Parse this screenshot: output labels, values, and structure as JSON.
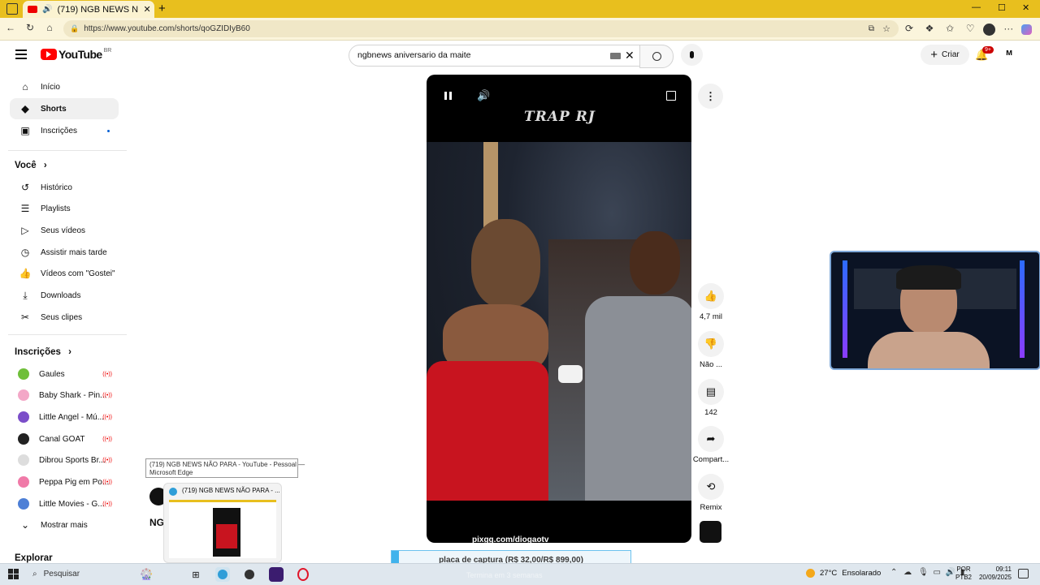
{
  "browser": {
    "tab_title": "(719) NGB NEWS NÃO PARA",
    "url": "https://www.youtube.com/shorts/qoGZIDIyB60",
    "window_minimize": "—",
    "window_maximize": "☐",
    "window_close": "✕"
  },
  "youtube": {
    "logo_text": "YouTube",
    "region": "BR",
    "search_value": "ngbnews aniversario da maite",
    "create_label": "Criar",
    "notif_count": "9+"
  },
  "sidebar": {
    "items": [
      {
        "label": "Início",
        "icon": "home-icon"
      },
      {
        "label": "Shorts",
        "icon": "shorts-icon"
      },
      {
        "label": "Inscrições",
        "icon": "subscriptions-icon"
      }
    ],
    "you_title": "Você",
    "you_items": [
      {
        "label": "Histórico"
      },
      {
        "label": "Playlists"
      },
      {
        "label": "Seus vídeos"
      },
      {
        "label": "Assistir mais tarde"
      },
      {
        "label": "Vídeos com \"Gostei\""
      },
      {
        "label": "Downloads"
      },
      {
        "label": "Seus clipes"
      }
    ],
    "subs_title": "Inscrições",
    "subs": [
      {
        "label": "Gaules",
        "color": "#6fbf3a"
      },
      {
        "label": "Baby Shark - Pin...",
        "color": "#f3a7c7"
      },
      {
        "label": "Little Angel - Mú...",
        "color": "#7b4ec9"
      },
      {
        "label": "Canal GOAT",
        "color": "#222222"
      },
      {
        "label": "Dibrou Sports Br...",
        "color": "#dddddd"
      },
      {
        "label": "Peppa Pig em Po...",
        "color": "#f07aa8"
      },
      {
        "label": "Little Movies - G...",
        "color": "#4d7fd6"
      }
    ],
    "show_more": "Mostrar mais",
    "explore_title": "Explorar"
  },
  "video": {
    "watermark": "TRAP RJ",
    "bottom_url": "pixgg.com/diogaotv"
  },
  "actions": {
    "likes": "4,7 mil",
    "dislike": "Não ...",
    "comments": "142",
    "share": "Compart...",
    "remix": "Remix"
  },
  "tooltip": {
    "line1": "(719) NGB NEWS NÃO PARA - YouTube - Pessoal —",
    "line2": "Microsoft Edge"
  },
  "preview": {
    "title": "(719) NGB NEWS NÃO PARA - ..."
  },
  "page_partial_text": "NG",
  "capture_banner": "placa de captura (R$ 32,00/R$ 899,00)",
  "taskbar": {
    "search_placeholder": "Pesquisar",
    "weather_temp": "27°C",
    "weather_text": "Ensolarado",
    "lang_line1": "POR",
    "lang_line2": "PTB2",
    "time": "09:11",
    "date": "20/09/2025",
    "ghost_text": "Termina em 3 semanas"
  }
}
